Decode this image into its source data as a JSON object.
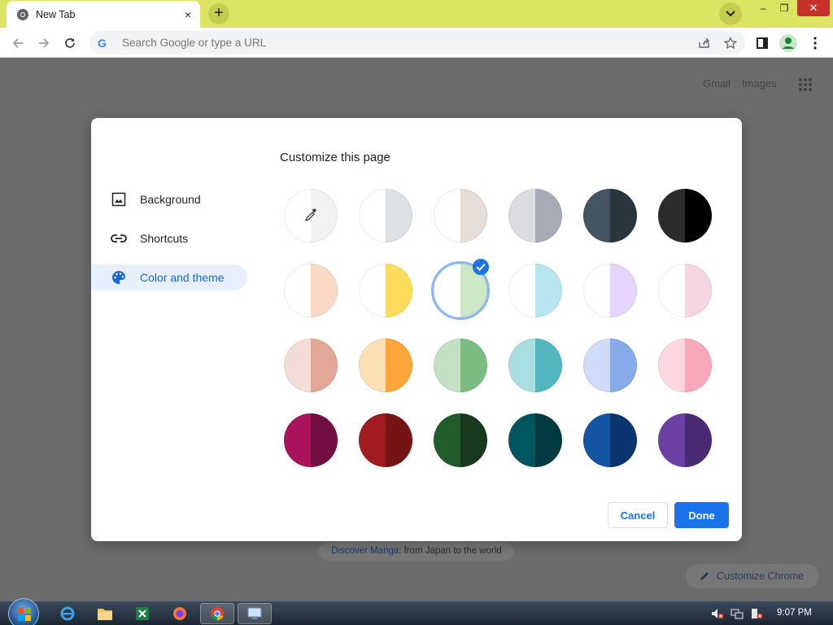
{
  "browser": {
    "tab": {
      "title": "New Tab",
      "favicon": "chrome-logo-icon",
      "close": "×"
    },
    "new_tab": "+",
    "window": {
      "minimize": "–",
      "maximize": "❐",
      "close": "✕"
    },
    "omnibox": {
      "placeholder": "Search Google or type a URL",
      "value": ""
    }
  },
  "ntp": {
    "links": [
      "Gmail",
      "Images"
    ],
    "promo": {
      "link_text": "Discover Manga",
      "rest": ": from Japan to the world"
    },
    "customize_chrome": "Customize Chrome"
  },
  "dialog": {
    "title": "Customize this page",
    "sidebar": [
      {
        "label": "Background",
        "icon": "image-icon",
        "active": false
      },
      {
        "label": "Shortcuts",
        "icon": "link-icon",
        "active": false
      },
      {
        "label": "Color and theme",
        "icon": "palette-icon",
        "active": true
      }
    ],
    "swatches": [
      {
        "left": "#ffffff",
        "right": "#f1f3f4",
        "picker": true
      },
      {
        "left": "#ffffff",
        "right": "#dee1e6"
      },
      {
        "left": "#ffffff",
        "right": "#e6ddd8"
      },
      {
        "left": "#dadce0",
        "right": "#a8abb6"
      },
      {
        "left": "#435562",
        "right": "#29363e"
      },
      {
        "left": "#2b2b2b",
        "right": "#000000"
      },
      {
        "left": "#ffffff",
        "right": "#fcd9c7"
      },
      {
        "left": "#ffffff",
        "right": "#fddc5c"
      },
      {
        "left": "#ffffff",
        "right": "#cde8c6",
        "selected": true
      },
      {
        "left": "#ffffff",
        "right": "#b8e6f0"
      },
      {
        "left": "#ffffff",
        "right": "#e6d5fb"
      },
      {
        "left": "#ffffff",
        "right": "#f7d6e3"
      },
      {
        "left": "#f3ddd6",
        "right": "#e3a797"
      },
      {
        "left": "#fde0b4",
        "right": "#fba73c"
      },
      {
        "left": "#c3e2c4",
        "right": "#7bbd80"
      },
      {
        "left": "#a9dfe0",
        "right": "#53b7c0"
      },
      {
        "left": "#cfdcf8",
        "right": "#87aae8"
      },
      {
        "left": "#fdd8e1",
        "right": "#f9a8bb"
      },
      {
        "left": "#a8135b",
        "right": "#720e40"
      },
      {
        "left": "#a01c1e",
        "right": "#741414"
      },
      {
        "left": "#215c2c",
        "right": "#19391f"
      },
      {
        "left": "#00565f",
        "right": "#003a3f"
      },
      {
        "left": "#1355a4",
        "right": "#0b356e"
      },
      {
        "left": "#6c3fa5",
        "right": "#4a2a72"
      }
    ],
    "buttons": {
      "cancel": "Cancel",
      "done": "Done"
    }
  },
  "taskbar": {
    "items": [
      "internet-explorer-icon",
      "file-explorer-icon",
      "excel-icon",
      "firefox-icon",
      "chrome-icon",
      "remote-desktop-icon"
    ],
    "tray": [
      "volume-muted-icon",
      "network-icon",
      "action-center-icon"
    ],
    "clock": "9:07 PM"
  },
  "colors": {
    "accent": "#1a73e8",
    "titlebar": "#dde463",
    "overlay": "#6b6b6b"
  }
}
